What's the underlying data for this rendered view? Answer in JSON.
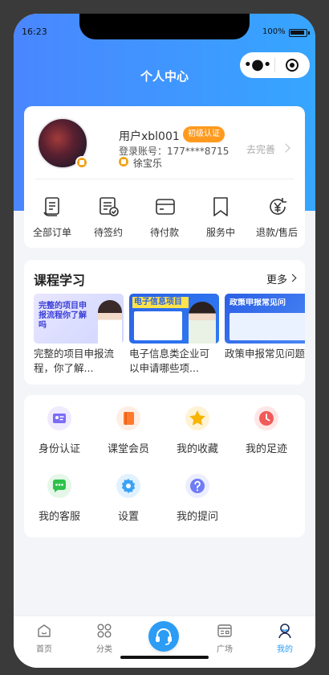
{
  "status_bar": {
    "time": "16:23",
    "battery": "100%"
  },
  "header": {
    "title": "个人中心",
    "capsule_more_icon": "more-dots-icon",
    "capsule_close_icon": "target-icon"
  },
  "profile": {
    "username": "用户xbl001",
    "level_badge": "初级认证",
    "account": "登录账号：177****8715",
    "school": "徐宝乐",
    "complete_label": "去完善"
  },
  "orders": [
    {
      "label": "全部订单",
      "icon": "document-list-icon"
    },
    {
      "label": "待签约",
      "icon": "contract-check-icon"
    },
    {
      "label": "待付款",
      "icon": "card-icon"
    },
    {
      "label": "服务中",
      "icon": "bookmark-icon"
    },
    {
      "label": "退款/售后",
      "icon": "refund-yen-icon"
    }
  ],
  "courses": {
    "title": "课程学习",
    "more_label": "更多",
    "items": [
      {
        "thumb_text": "完整的项目申报流程你了解吗",
        "title": "完整的项目申报流程，你了解..."
      },
      {
        "thumb_text": "电子信息项目",
        "title": "电子信息类企业可以申请哪些项..."
      },
      {
        "thumb_text": "政策申报常见问",
        "title": "政策申报常见问题"
      }
    ]
  },
  "menu": [
    {
      "label": "身份认证",
      "icon": "id-card-icon",
      "color": "#7b6cf6"
    },
    {
      "label": "课堂会员",
      "icon": "book-icon",
      "color": "#ff7a2d"
    },
    {
      "label": "我的收藏",
      "icon": "star-icon",
      "color": "#f7b500"
    },
    {
      "label": "我的足迹",
      "icon": "clock-icon",
      "color": "#f25a5a"
    },
    {
      "label": "我的客服",
      "icon": "chat-icon",
      "color": "#2ec24a"
    },
    {
      "label": "设置",
      "icon": "gear-icon",
      "color": "#3aa3f5"
    },
    {
      "label": "我的提问",
      "icon": "question-icon",
      "color": "#6f7cf7"
    }
  ],
  "tabbar": [
    {
      "label": "首页",
      "icon": "home-icon"
    },
    {
      "label": "分类",
      "icon": "grid-icon"
    },
    {
      "label": "",
      "icon": "headset-icon"
    },
    {
      "label": "广场",
      "icon": "square-icon"
    },
    {
      "label": "我的",
      "icon": "profile-icon"
    }
  ],
  "colors": {
    "accent": "#2d9cf5",
    "badge": "#ff9a1f",
    "active_tab": "#2d9cf5"
  }
}
